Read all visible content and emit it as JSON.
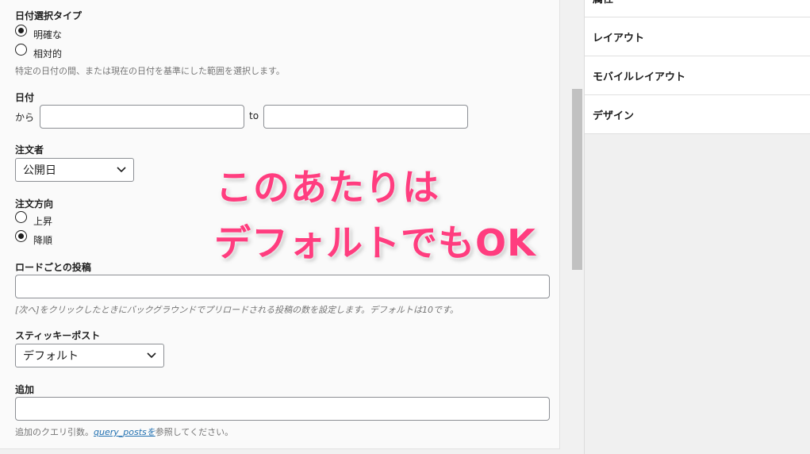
{
  "form": {
    "date_type": {
      "label": "日付選択タイプ",
      "options": [
        "明確な",
        "相対的"
      ],
      "selected": 0,
      "help": "特定の日付の間、または現在の日付を基準にした範囲を選択します。"
    },
    "date": {
      "label": "日付",
      "from_label": "から",
      "to_label": "to",
      "from_value": "",
      "to_value": ""
    },
    "orderby": {
      "label": "注文者",
      "value": "公開日"
    },
    "order": {
      "label": "注文方向",
      "options": [
        "上昇",
        "降順"
      ],
      "selected": 1
    },
    "preload": {
      "label": "ロードごとの投稿",
      "value": "",
      "help": "[次へ]をクリックしたときにバックグラウンドでプリロードされる投稿の数を設定します。デフォルトは10です。"
    },
    "sticky": {
      "label": "スティッキーポスト",
      "value": "デフォルト"
    },
    "additional": {
      "label": "追加",
      "value": "",
      "help_prefix": "追加のクエリ引数。",
      "help_link": "query_postsを",
      "help_suffix": "参照してください。"
    }
  },
  "sidebar": {
    "items": [
      {
        "label": "属性"
      },
      {
        "label": "レイアウト"
      },
      {
        "label": "モバイルレイアウト"
      },
      {
        "label": "デザイン"
      }
    ]
  },
  "overlay": {
    "line1": "このあたりは",
    "line2": "デフォルトでもOK",
    "color": "#ff3d7f"
  }
}
